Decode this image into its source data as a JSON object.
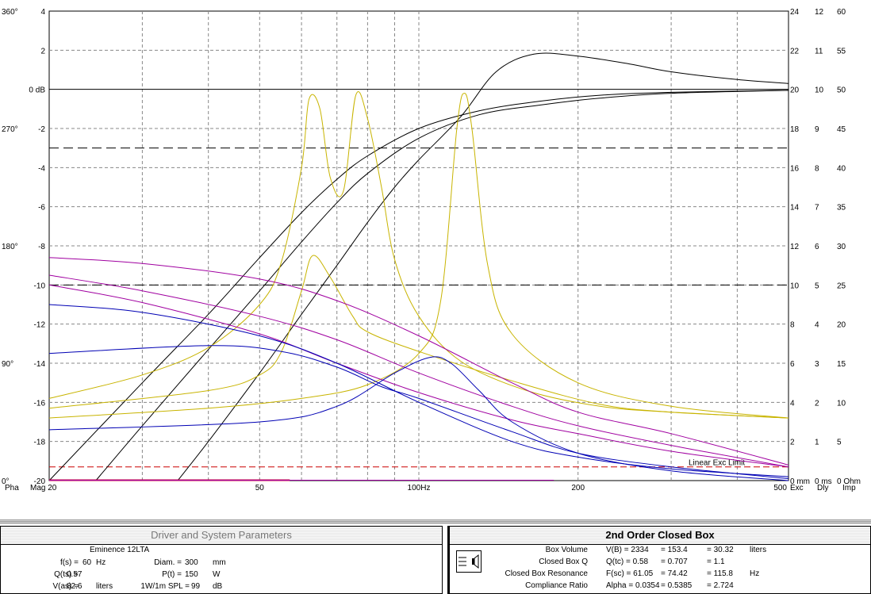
{
  "chart_data": {
    "type": "line",
    "x_axis": {
      "scale": "log",
      "range": [
        20,
        500
      ],
      "ticks": [
        {
          "v": 20,
          "label": "Mag 20"
        },
        {
          "v": 50,
          "label": "50"
        },
        {
          "v": 100,
          "label": "100Hz"
        },
        {
          "v": 200,
          "label": "200"
        },
        {
          "v": 500,
          "label": "500"
        }
      ]
    },
    "y_left_mag": {
      "range": [
        -20,
        4
      ],
      "ticks": [
        4,
        2,
        "0 dB",
        -2,
        -4,
        -6,
        -8,
        -10,
        -12,
        -14,
        -16,
        -18,
        -20
      ]
    },
    "y_left_phase": {
      "ticks": [
        "360°",
        "270°",
        "180°",
        "90°",
        "0°"
      ]
    },
    "y_right_excursion": {
      "ticks": [
        24,
        22,
        20,
        18,
        16,
        14,
        12,
        10,
        8,
        6,
        4,
        2,
        "0 mm"
      ]
    },
    "y_right_delay": {
      "ticks": [
        12,
        11,
        10,
        9,
        8,
        7,
        6,
        5,
        4,
        3,
        2,
        1,
        "0 ms"
      ]
    },
    "y_right_impedance": {
      "ticks": [
        60,
        55,
        50,
        45,
        40,
        35,
        30,
        25,
        20,
        15,
        10,
        5,
        "0 Ohm"
      ]
    },
    "axis_labels": {
      "phase": "Pha",
      "exc": "Exc",
      "dly": "Dly",
      "imp": "Imp"
    },
    "colors": {
      "magnitude": "#000000",
      "impedance": "#c8b400",
      "phase": "#a000a0",
      "delay": "#0000b4",
      "limit": "#cc0000"
    },
    "reference_lines": [
      {
        "y": -3,
        "style": "dashed"
      },
      {
        "y": -10,
        "style": "dashed"
      },
      {
        "y": -19.3,
        "style": "dashed-red",
        "label": "Linear Exc Limit"
      }
    ],
    "series": [
      {
        "kind": "magnitude",
        "points": [
          [
            20,
            -20
          ],
          [
            30,
            -15
          ],
          [
            40,
            -11.5
          ],
          [
            50,
            -8.6
          ],
          [
            60,
            -6.3
          ],
          [
            70,
            -4.6
          ],
          [
            80,
            -3.4
          ],
          [
            100,
            -2.0
          ],
          [
            130,
            -1.1
          ],
          [
            170,
            -0.6
          ],
          [
            220,
            -0.3
          ],
          [
            300,
            -0.15
          ],
          [
            500,
            -0.05
          ]
        ]
      },
      {
        "kind": "magnitude",
        "points": [
          [
            24.5,
            -20
          ],
          [
            30,
            -17.2
          ],
          [
            40,
            -13.3
          ],
          [
            50,
            -10.3
          ],
          [
            60,
            -7.8
          ],
          [
            70,
            -5.8
          ],
          [
            80,
            -4.3
          ],
          [
            100,
            -2.5
          ],
          [
            130,
            -1.3
          ],
          [
            170,
            -0.8
          ],
          [
            220,
            -0.45
          ],
          [
            300,
            -0.2
          ],
          [
            500,
            -0.05
          ]
        ]
      },
      {
        "kind": "magnitude",
        "points": [
          [
            35,
            -20
          ],
          [
            40,
            -18
          ],
          [
            50,
            -14.5
          ],
          [
            60,
            -11.5
          ],
          [
            70,
            -9
          ],
          [
            80,
            -6.8
          ],
          [
            90,
            -5
          ],
          [
            100,
            -3.6
          ],
          [
            120,
            -1.4
          ],
          [
            140,
            0.9
          ],
          [
            165,
            1.8
          ],
          [
            200,
            1.7
          ],
          [
            250,
            1.3
          ],
          [
            300,
            0.9
          ],
          [
            400,
            0.5
          ],
          [
            500,
            0.3
          ]
        ]
      },
      {
        "kind": "impedance",
        "points": [
          [
            20,
            -15.8
          ],
          [
            30,
            -14.6
          ],
          [
            40,
            -13.2
          ],
          [
            50,
            -11
          ],
          [
            55,
            -8.8
          ],
          [
            60,
            -4
          ],
          [
            62,
            -0.5
          ],
          [
            65,
            -1
          ],
          [
            68,
            -4.5
          ],
          [
            72,
            -5.2
          ],
          [
            76,
            -0.3
          ],
          [
            80,
            -1.5
          ],
          [
            85,
            -5
          ],
          [
            90,
            -8.7
          ],
          [
            100,
            -11.6
          ],
          [
            120,
            -13.9
          ],
          [
            160,
            -15.4
          ],
          [
            220,
            -16.2
          ],
          [
            300,
            -16.5
          ],
          [
            500,
            -16.8
          ]
        ]
      },
      {
        "kind": "impedance",
        "points": [
          [
            20,
            -16.3
          ],
          [
            40,
            -15.4
          ],
          [
            50,
            -14.6
          ],
          [
            55,
            -13.4
          ],
          [
            60,
            -10.3
          ],
          [
            63,
            -8.5
          ],
          [
            68,
            -9.6
          ],
          [
            75,
            -11.6
          ],
          [
            80,
            -12.4
          ],
          [
            100,
            -13.4
          ],
          [
            150,
            -14.9
          ],
          [
            220,
            -16.1
          ],
          [
            300,
            -16.5
          ],
          [
            500,
            -16.8
          ]
        ]
      },
      {
        "kind": "impedance",
        "points": [
          [
            20,
            -16.8
          ],
          [
            40,
            -16.3
          ],
          [
            60,
            -15.8
          ],
          [
            80,
            -15.1
          ],
          [
            100,
            -13.5
          ],
          [
            110,
            -10.8
          ],
          [
            118,
            -2
          ],
          [
            122,
            -0.2
          ],
          [
            126,
            -2
          ],
          [
            135,
            -9
          ],
          [
            150,
            -12.5
          ],
          [
            200,
            -15
          ],
          [
            300,
            -16.2
          ],
          [
            500,
            -16.8
          ]
        ]
      },
      {
        "kind": "phase",
        "points": [
          [
            20,
            -8.6
          ],
          [
            30,
            -8.9
          ],
          [
            50,
            -9.7
          ],
          [
            70,
            -10.8
          ],
          [
            100,
            -12.6
          ],
          [
            150,
            -15
          ],
          [
            200,
            -16.5
          ],
          [
            300,
            -17.6
          ],
          [
            500,
            -19.2
          ]
        ]
      },
      {
        "kind": "phase",
        "points": [
          [
            20,
            -9.5
          ],
          [
            30,
            -10.3
          ],
          [
            50,
            -11.6
          ],
          [
            70,
            -12.8
          ],
          [
            100,
            -14.5
          ],
          [
            150,
            -16.2
          ],
          [
            200,
            -17.2
          ],
          [
            300,
            -18.2
          ],
          [
            500,
            -19.3
          ]
        ]
      },
      {
        "kind": "phase",
        "points": [
          [
            20,
            -10.0
          ],
          [
            30,
            -10.9
          ],
          [
            50,
            -12.5
          ],
          [
            70,
            -14
          ],
          [
            100,
            -15.5
          ],
          [
            150,
            -16.9
          ],
          [
            200,
            -17.6
          ],
          [
            300,
            -18.5
          ],
          [
            500,
            -19.3
          ]
        ]
      },
      {
        "kind": "delay",
        "points": [
          [
            20,
            -11.0
          ],
          [
            30,
            -11.4
          ],
          [
            50,
            -12.6
          ],
          [
            70,
            -14
          ],
          [
            100,
            -16
          ],
          [
            150,
            -18
          ],
          [
            200,
            -18.8
          ],
          [
            300,
            -19.4
          ],
          [
            500,
            -19.8
          ]
        ]
      },
      {
        "kind": "delay",
        "points": [
          [
            20,
            -13.5
          ],
          [
            40,
            -13.1
          ],
          [
            55,
            -13.4
          ],
          [
            70,
            -14.2
          ],
          [
            85,
            -15.2
          ],
          [
            100,
            -15.8
          ],
          [
            150,
            -17.5
          ],
          [
            200,
            -18.6
          ],
          [
            300,
            -19.3
          ],
          [
            500,
            -19.9
          ]
        ]
      },
      {
        "kind": "delay",
        "points": [
          [
            20,
            -17.4
          ],
          [
            50,
            -17
          ],
          [
            70,
            -16.2
          ],
          [
            90,
            -14.5
          ],
          [
            105,
            -13.7
          ],
          [
            115,
            -14
          ],
          [
            130,
            -15.4
          ],
          [
            150,
            -17
          ],
          [
            200,
            -18.6
          ],
          [
            300,
            -19.5
          ],
          [
            500,
            -20
          ]
        ]
      }
    ]
  },
  "left_panel": {
    "title": "Driver and System Parameters",
    "driver_name": "Eminence  12LTA",
    "rows": [
      {
        "label": "f(s) =",
        "value": "60",
        "unit": "Hz",
        "label2": "Diam. =",
        "value2": "300",
        "unit2": "mm"
      },
      {
        "label": "Q(ts) =",
        "value": "0.57",
        "unit": "",
        "label2": "P(t) =",
        "value2": "150",
        "unit2": "W"
      },
      {
        "label": "V(as) =",
        "value": "82.6",
        "unit": "liters",
        "label2": "1W/1m SPL =",
        "value2": "99",
        "unit2": "dB"
      }
    ]
  },
  "right_panel": {
    "title": "2nd Order Closed Box",
    "rows": [
      {
        "label": "Box Volume",
        "c1": "V(B) = 2334",
        "c2": "= 153.4",
        "c3": "= 30.32",
        "unit": "liters"
      },
      {
        "label": "Closed Box Q",
        "c1": "Q(tc) = 0.58",
        "c2": "= 0.707",
        "c3": "= 1.1",
        "unit": ""
      },
      {
        "label": "Closed Box Resonance",
        "c1": "F(sc) = 61.05",
        "c2": "= 74.42",
        "c3": "= 115.8",
        "unit": "Hz"
      },
      {
        "label": "Compliance Ratio",
        "c1": "Alpha = 0.0354",
        "c2": "= 0.5385",
        "c3": "= 2.724",
        "unit": ""
      }
    ]
  }
}
